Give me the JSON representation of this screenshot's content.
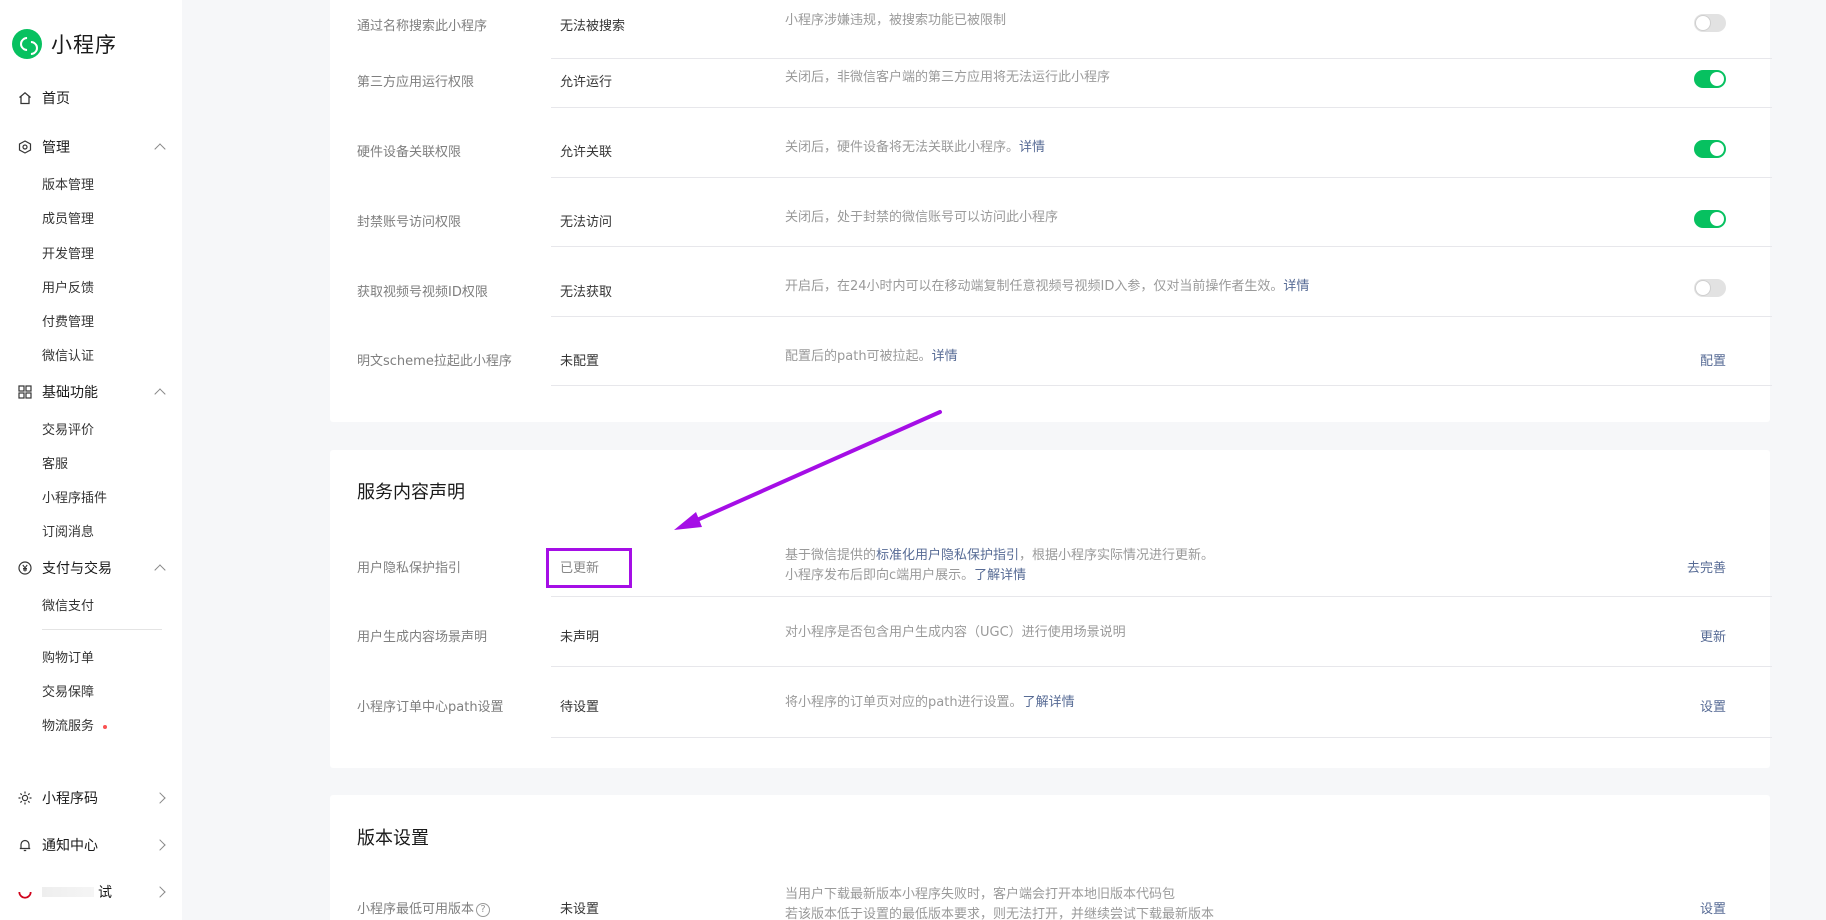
{
  "app": {
    "title": "小程序"
  },
  "sidebar": {
    "home": "首页",
    "manage": {
      "label": "管理",
      "items": [
        "版本管理",
        "成员管理",
        "开发管理",
        "用户反馈",
        "付费管理",
        "微信认证"
      ]
    },
    "basic": {
      "label": "基础功能",
      "items": [
        "交易评价",
        "客服",
        "小程序插件",
        "订阅消息"
      ]
    },
    "pay": {
      "label": "支付与交易",
      "items": [
        "微信支付"
      ]
    },
    "pay_extra": [
      "购物订单",
      "交易保障",
      "物流服务"
    ],
    "bottom": [
      "小程序码",
      "通知中心",
      "试"
    ]
  },
  "permissions": {
    "rows": [
      {
        "label": "通过名称搜索此小程序",
        "value": "无法被搜索",
        "desc": "小程序涉嫌违规，被搜索功能已被限制",
        "switch": "off"
      },
      {
        "label": "第三方应用运行权限",
        "value": "允许运行",
        "desc": "关闭后，非微信客户端的第三方应用将无法运行此小程序",
        "switch": "on"
      },
      {
        "label": "硬件设备关联权限",
        "value": "允许关联",
        "desc": "关闭后，硬件设备将无法关联此小程序。",
        "link": "详情",
        "switch": "on"
      },
      {
        "label": "封禁账号访问权限",
        "value": "无法访问",
        "desc": "关闭后，处于封禁的微信账号可以访问此小程序",
        "switch": "on"
      },
      {
        "label": "获取视频号视频ID权限",
        "value": "无法获取",
        "desc": "开启后，在24小时内可以在移动端复制任意视频号视频ID入参，仅对当前操作者生效。",
        "link": "详情",
        "switch": "off"
      },
      {
        "label": "明文scheme拉起此小程序",
        "value": "未配置",
        "desc": "配置后的path可被拉起。",
        "link": "详情",
        "action": "配置"
      }
    ]
  },
  "service": {
    "title": "服务内容声明",
    "privacy": {
      "label": "用户隐私保护指引",
      "value": "已更新",
      "desc_pre": "基于微信提供的",
      "desc_link": "标准化用户隐私保护指引",
      "desc_post": "，根据小程序实际情况进行更新。",
      "desc2_pre": "小程序发布后即向c端用户展示。",
      "desc2_link": "了解详情",
      "action": "去完善"
    },
    "ugc": {
      "label": "用户生成内容场景声明",
      "value": "未声明",
      "desc": "对小程序是否包含用户生成内容（UGC）进行使用场景说明",
      "action": "更新"
    },
    "order": {
      "label": "小程序订单中心path设置",
      "value": "待设置",
      "desc": "将小程序的订单页对应的path进行设置。",
      "link": "了解详情",
      "action": "设置"
    }
  },
  "version": {
    "title": "版本设置",
    "min": {
      "label": "小程序最低可用版本",
      "help": "?",
      "value": "未设置",
      "desc": "当用户下载最新版本小程序失败时，客户端会打开本地旧版本代码包",
      "desc2": "若该版本低于设置的最低版本要求，则无法打开，并继续尝试下载最新版本",
      "action": "设置"
    }
  },
  "colors": {
    "accent": "#07c160",
    "link": "#576b95",
    "annotation": "#a50ee6"
  },
  "icons": [
    "home-icon",
    "settings-hex-icon",
    "grid-icon",
    "yen-circle-icon",
    "sun-icon",
    "bell-icon"
  ]
}
